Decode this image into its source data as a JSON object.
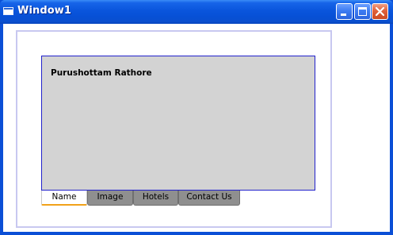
{
  "window": {
    "title": "Window1",
    "icon": "app-window-icon",
    "controls": {
      "minimize": "minimize-icon",
      "maximize": "maximize-icon",
      "close": "close-icon"
    }
  },
  "panel": {
    "text": "Purushottam Rathore"
  },
  "tabs": [
    {
      "label": "Name",
      "selected": true
    },
    {
      "label": "Image",
      "selected": false
    },
    {
      "label": "Hotels",
      "selected": false
    },
    {
      "label": "Contact Us",
      "selected": false
    }
  ],
  "colors": {
    "titlebar": "#0a55dc",
    "panel_background": "#d3d3d3",
    "panel_border": "#2222cc",
    "tab_inactive": "#8f8f8f",
    "tab_selected_accent": "#f1a21a",
    "frame_border": "#c8c8f0"
  }
}
